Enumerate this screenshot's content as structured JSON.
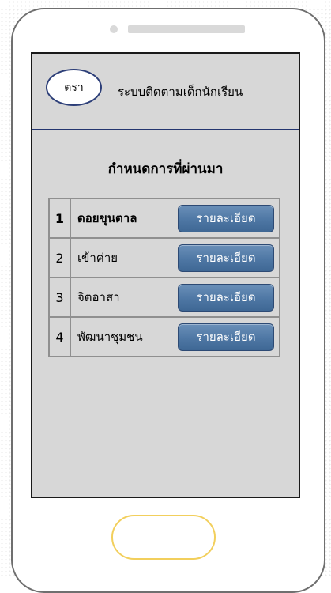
{
  "header": {
    "logo_text": "ตรา",
    "app_title": "ระบบติดตามเด็กนักเรียน"
  },
  "section": {
    "title": "กำหนดการที่ผ่านมา"
  },
  "items": [
    {
      "number": "1",
      "name": "ดอยขุนตาล",
      "button_label": "รายละเอียด"
    },
    {
      "number": "2",
      "name": "เข้าค่าย",
      "button_label": "รายละเอียด"
    },
    {
      "number": "3",
      "name": "จิตอาสา",
      "button_label": "รายละเอียด"
    },
    {
      "number": "4",
      "name": "พัฒนาชุมชน",
      "button_label": "รายละเอียด"
    }
  ],
  "colors": {
    "screen_bg": "#d7d7d7",
    "accent_line": "#24356f",
    "button": "#4e77a4",
    "home_button_border": "#f2cf5c"
  }
}
